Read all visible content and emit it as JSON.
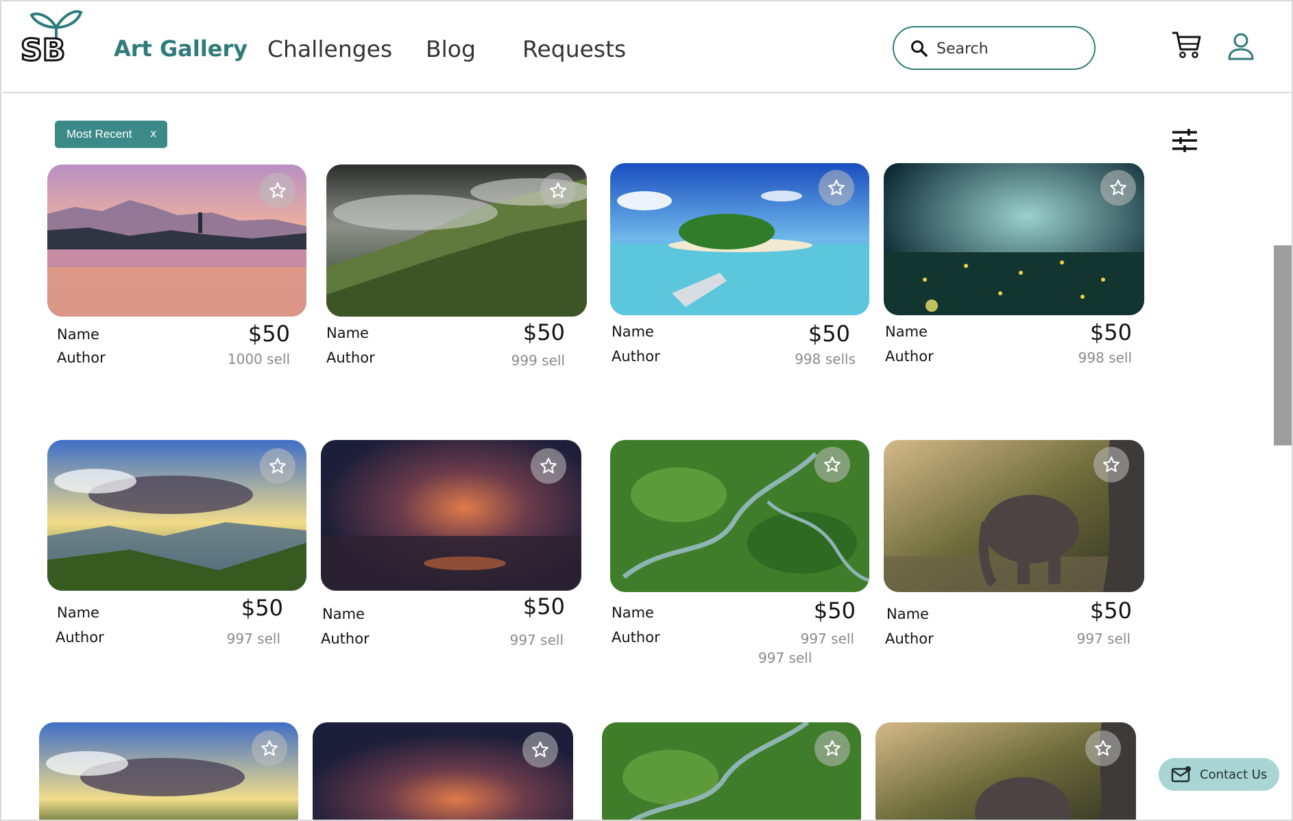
{
  "header": {
    "brand": "Art Gallery",
    "logo_text": "SB",
    "nav": [
      {
        "label": "Challenges"
      },
      {
        "label": "Blog"
      },
      {
        "label": "Requests"
      }
    ],
    "search_placeholder": "Search",
    "cart_icon": "cart-icon",
    "user_icon": "user-icon"
  },
  "filters": {
    "active_chip": "Most Recent",
    "chip_close": "x",
    "filter_icon": "sliders-icon"
  },
  "cards": [
    {
      "name": "Name",
      "author": "Author",
      "price": "$50",
      "sells": "1000 sell",
      "scene": "lake-sunset"
    },
    {
      "name": "Name",
      "author": "Author",
      "price": "$50",
      "sells": "999 sell",
      "scene": "misty-hills"
    },
    {
      "name": "Name",
      "author": "Author",
      "price": "$50",
      "sells": "998 sells",
      "scene": "tropical-island"
    },
    {
      "name": "Name",
      "author": "Author",
      "price": "$50",
      "sells": "998 sell",
      "scene": "enchanted-forest"
    },
    {
      "name": "Name",
      "author": "Author",
      "price": "$50",
      "sells": "997 sell",
      "scene": "mountain-sunrays"
    },
    {
      "name": "Name",
      "author": "Author",
      "price": "$50",
      "sells": "997 sell",
      "scene": "storm-lightning"
    },
    {
      "name": "Name",
      "author": "Author",
      "price": "$50",
      "sells": "997 sell",
      "scene": "green-river"
    },
    {
      "name": "Name",
      "author": "Author",
      "price": "$50",
      "sells": "997 sell",
      "scene": "baby-elephant"
    }
  ],
  "extra_sells": "997 sell",
  "contact": {
    "label": "Contact Us",
    "icon": "mail-icon"
  },
  "colors": {
    "accent": "#2e7b79",
    "chip": "#3b8a88",
    "contact_bg": "#a9d6d4"
  }
}
